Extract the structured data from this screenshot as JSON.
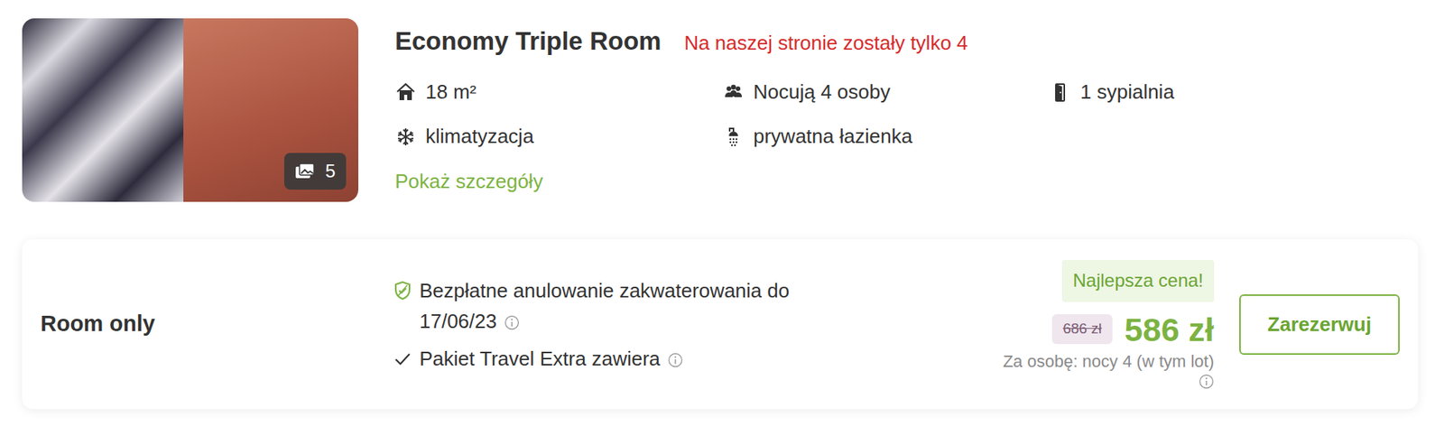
{
  "room": {
    "title": "Economy Triple Room",
    "availability": "Na naszej stronie zostały tylko 4",
    "photo_count": "5",
    "features": [
      {
        "kind": "area",
        "text": "18 m²"
      },
      {
        "kind": "guests",
        "text": "Nocują 4 osoby"
      },
      {
        "kind": "bedrooms",
        "text": "1 sypialnia"
      },
      {
        "kind": "aircon",
        "text": "klimatyzacja"
      },
      {
        "kind": "bathroom",
        "text": "prywatna łazienka"
      }
    ],
    "details_link": "Pokaż szczegóły"
  },
  "offer": {
    "board": "Room only",
    "perks": [
      {
        "kind": "cancellation",
        "text": "Bezpłatne anulowanie zakwaterowania do 17/06/23"
      },
      {
        "kind": "included",
        "text": "Pakiet Travel Extra zawiera"
      }
    ],
    "badge": "Najlepsza cena!",
    "old_price": "686 zł",
    "price": "586 zł",
    "price_note": "Za osobę: nocy 4 (w tym lot)",
    "button": "Zarezerwuj"
  }
}
